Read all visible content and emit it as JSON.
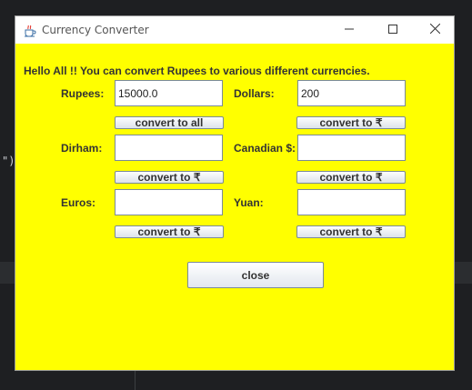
{
  "window": {
    "title": "Currency Converter"
  },
  "background": {
    "code_fragment": "\")"
  },
  "heading": "Hello All !! You can convert Rupees to various different currencies.",
  "fields": {
    "rupees": {
      "label": "Rupees:",
      "value": "15000.0"
    },
    "dollars": {
      "label": "Dollars:",
      "value": "200"
    },
    "dirham": {
      "label": "Dirham:",
      "value": ""
    },
    "canadian": {
      "label": "Canadian $:",
      "value": ""
    },
    "euros": {
      "label": "Euros:",
      "value": ""
    },
    "yuan": {
      "label": "Yuan:",
      "value": ""
    }
  },
  "buttons": {
    "convert_all": "convert to all",
    "convert_dollars": "convert to ₹",
    "convert_dirham": "convert to ₹",
    "convert_canadian": "convert to ₹",
    "convert_euros": "convert to ₹",
    "convert_yuan": "convert to ₹",
    "close": "close"
  },
  "colors": {
    "window_background": "#ffff00",
    "desktop_background": "#1e1f22"
  },
  "icons": {
    "app": "java-coffee-cup-icon",
    "minimize": "minimize-icon",
    "maximize": "maximize-icon",
    "close": "close-icon"
  }
}
